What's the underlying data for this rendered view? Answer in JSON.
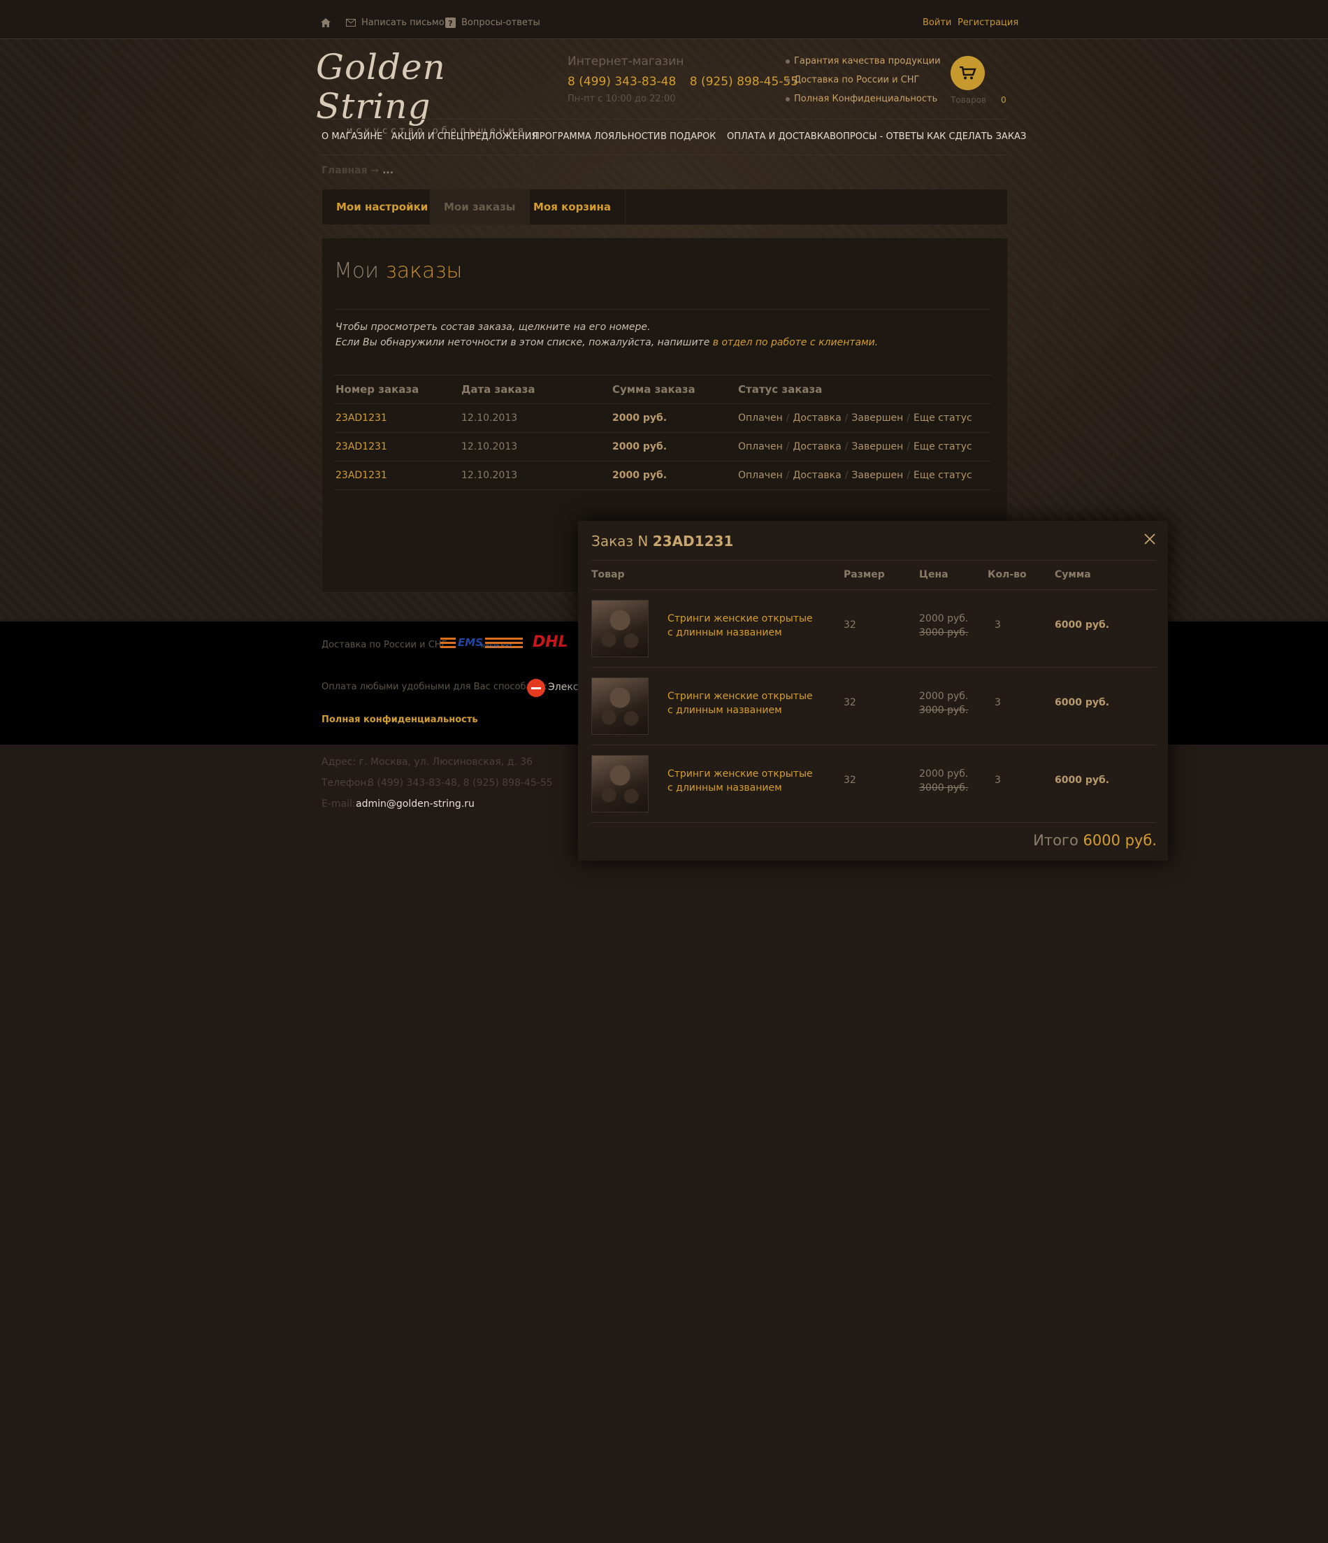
{
  "topbar": {
    "write_label": "Написать письмо",
    "faq_label": "Вопросы-ответы",
    "login_label": "Войти",
    "register_label": "Регистрация"
  },
  "header": {
    "logo_main": "Golden String",
    "logo_sub": "искусство обольщения",
    "shop_label": "Интернет-магазин",
    "phone1": "8 (499) 343-83-48",
    "phone2": "8 (925) 898-45-55",
    "hours": "Пн-пт с 10:00 до 22:00",
    "guarantees": [
      "Гарантия качества продукции",
      "Доставка по России и СНГ",
      "Полная Конфиденциальность"
    ],
    "cart_label": "Товаров",
    "cart_count": "0"
  },
  "nav": [
    "О МАГАЗИНЕ",
    "АКЦИИ И СПЕЦПРЕДЛОЖЕНИЯ",
    "ПРОГРАММА ЛОЯЛЬНОСТИ",
    "В ПОДАРОК",
    "ОПЛАТА И ДОСТАВКА",
    "ВОПРОСЫ - ОТВЕТЫ",
    "КАК СДЕЛАТЬ ЗАКАЗ"
  ],
  "breadcrumb": {
    "home": "Главная",
    "sep": " → ",
    "current": "..."
  },
  "tabs": [
    "Мои настройки",
    "Мои заказы",
    "Моя корзина"
  ],
  "orders": {
    "title_a": "Мои ",
    "title_b": "заказы",
    "note1": "Чтобы просмотреть состав заказа, щелкните на его номере.",
    "note2": "Если Вы обнаружили неточности в этом списке, пожалуйста, напишите ",
    "note2_link": "в отдел по работе с клиентами.",
    "headers": [
      "Номер заказа",
      "Дата заказа",
      "Сумма заказа",
      "Статус заказа"
    ],
    "rows": [
      {
        "num": "23AD1231",
        "date": "12.10.2013",
        "sum": "2000 руб."
      },
      {
        "num": "23AD1231",
        "date": "12.10.2013",
        "sum": "2000 руб."
      },
      {
        "num": "23AD1231",
        "date": "12.10.2013",
        "sum": "2000 руб."
      }
    ],
    "statuses": [
      "Оплачен",
      "Доставка",
      "Завершен",
      "Еще статус"
    ],
    "status_sep": "/"
  },
  "footer": {
    "delivery_label": "Доставка по России и СНГ:",
    "ems": "EMS",
    "ems_sub": "RUSSIAN POST",
    "dhl": "DHL",
    "payment_label": "Оплата любыми удобными для Вас способами:",
    "payment_partial": "Элекс",
    "privacy": "Полная конфиденциальность",
    "address_label": "Адрес: г. Москва, ул. Люсиновская, д. 36",
    "phone_label": "Телефон:",
    "phone_value": "8 (499) 343-83-48, 8 (925) 898-45-55",
    "email_label": "E-mail:",
    "email_value": "admin@golden-string.ru"
  },
  "modal": {
    "title_prefix": "Заказ N ",
    "order_num": "23AD1231",
    "headers": [
      "Товар",
      "Размер",
      "Цена",
      "Кол-во",
      "Сумма"
    ],
    "items": [
      {
        "name1": "Стринги женские открытые",
        "name2": "с длинным названием",
        "size": "32",
        "price": "2000 руб.",
        "old_price": "3000 руб.",
        "qty": "3",
        "sum": "6000 руб."
      },
      {
        "name1": "Стринги женские открытые",
        "name2": "с длинным названием",
        "size": "32",
        "price": "2000 руб.",
        "old_price": "3000 руб.",
        "qty": "3",
        "sum": "6000 руб."
      },
      {
        "name1": "Стринги женские открытые",
        "name2": "с длинным названием",
        "size": "32",
        "price": "2000 руб.",
        "old_price": "3000 руб.",
        "qty": "3",
        "sum": "6000 руб."
      }
    ],
    "total_label": "Итого ",
    "total_value": "6000 руб."
  },
  "colors": {
    "accent": "#d39e2e",
    "background": "#211a16",
    "footer_band": "#000000"
  },
  "icons": [
    "home-icon",
    "mail-icon",
    "question-icon",
    "cart-icon",
    "close-icon"
  ]
}
